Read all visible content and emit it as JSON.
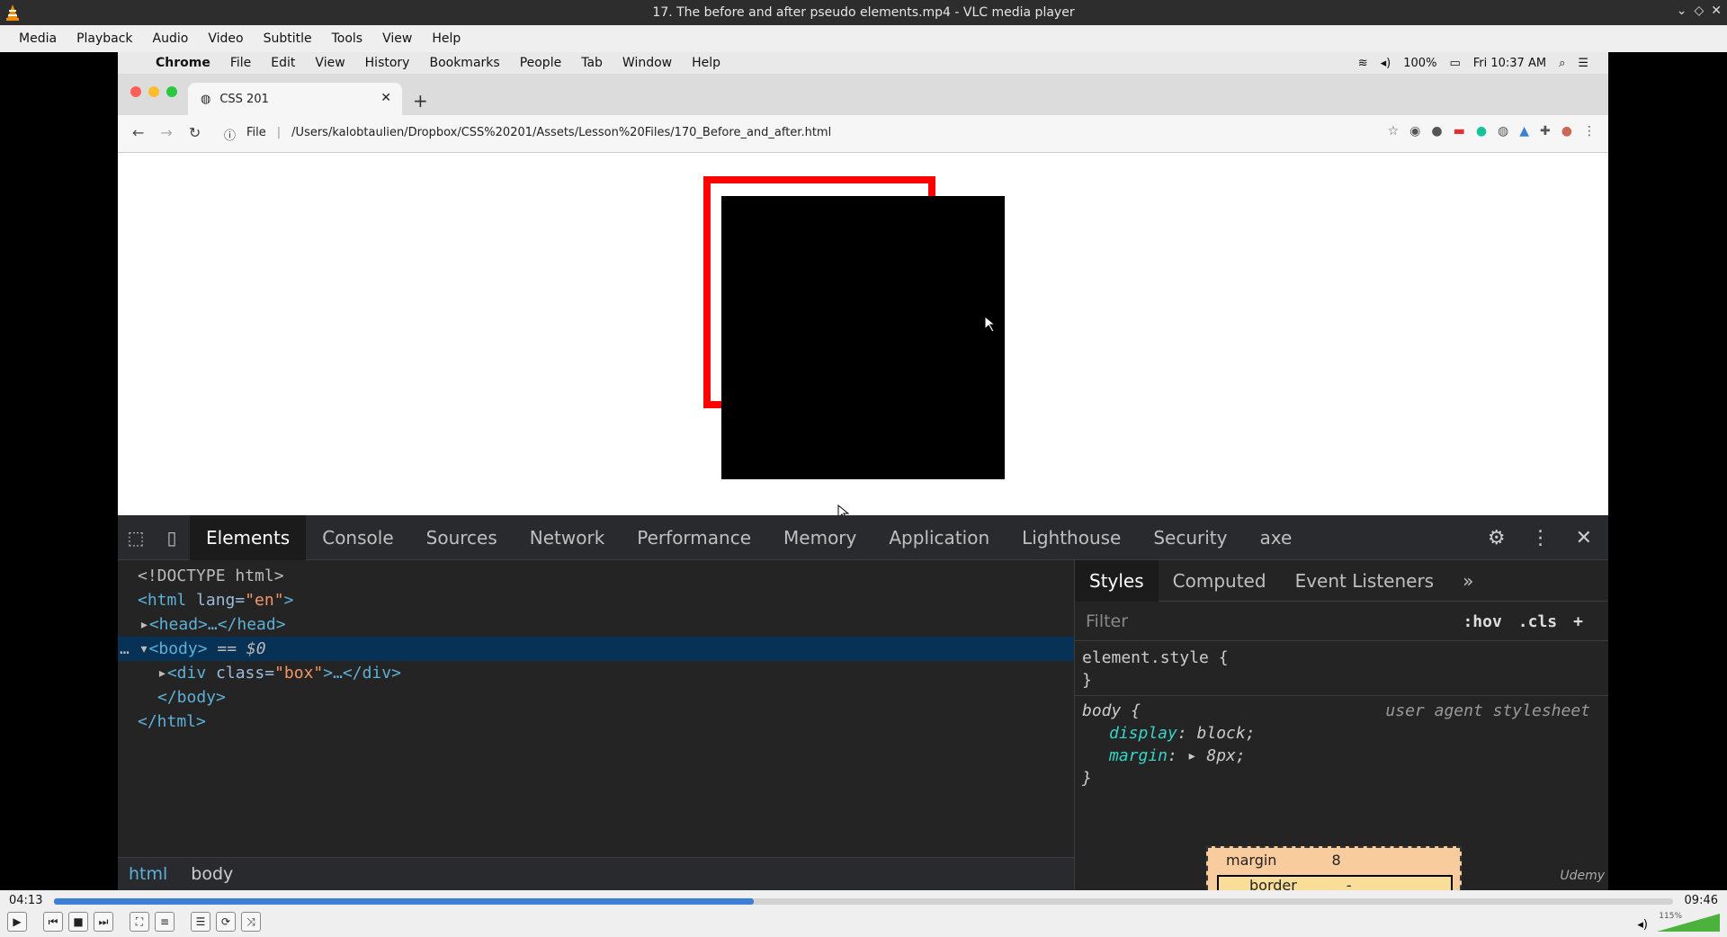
{
  "vlc": {
    "title": "17. The before and after pseudo elements.mp4 - VLC media player",
    "menu": [
      "Media",
      "Playback",
      "Audio",
      "Video",
      "Subtitle",
      "Tools",
      "View",
      "Help"
    ],
    "elapsed": "04:13",
    "total": "09:46",
    "progress": 0.432,
    "volume_label": "115%"
  },
  "mac": {
    "apple": "",
    "menu": [
      "Chrome",
      "File",
      "Edit",
      "View",
      "History",
      "Bookmarks",
      "People",
      "Tab",
      "Window",
      "Help"
    ],
    "battery": "100%",
    "clock": "Fri 10:37 AM"
  },
  "chrome": {
    "tab_title": "CSS 201",
    "url_scheme": "File",
    "url": "/Users/kalobtaulien/Dropbox/CSS%20201/Assets/Lesson%20Files/170_Before_and_after.html"
  },
  "page": {
    "before_color": "#ff0000",
    "after_color": "#0000ff",
    "box_color": "#000000"
  },
  "devtools": {
    "tabs": [
      "Elements",
      "Console",
      "Sources",
      "Network",
      "Performance",
      "Memory",
      "Application",
      "Lighthouse",
      "Security",
      "axe"
    ],
    "dom": {
      "doctype": "<!DOCTYPE html>",
      "html_open_tag": "<html ",
      "html_attr": "lang=",
      "html_val": "\"en\"",
      "html_close_bracket": ">",
      "head": "<head>…</head>",
      "body_open": "<body>",
      "body_eq": " == $0",
      "div_open": "<div ",
      "div_attr": "class=",
      "div_val": "\"box\"",
      "div_rest": ">…</div>",
      "body_close": "</body>",
      "html_close": "</html>"
    },
    "breadcrumbs": [
      "html",
      "body"
    ],
    "styles_tabs": [
      "Styles",
      "Computed",
      "Event Listeners",
      "»"
    ],
    "filter_placeholder": "Filter",
    "filter_buttons": [
      ":hov",
      ".cls",
      "+"
    ],
    "rules": {
      "element_style_open": "element.style {",
      "close": "}",
      "body_selector": "body {",
      "ua_label": "user agent stylesheet",
      "display_prop": "display",
      "display_val": " block;",
      "margin_prop": "margin",
      "margin_val": " 8px;"
    },
    "boxmodel": {
      "margin_label": "margin",
      "margin_value": "8",
      "border_label": "border",
      "border_value": "-"
    },
    "udemy": "Udemy"
  }
}
